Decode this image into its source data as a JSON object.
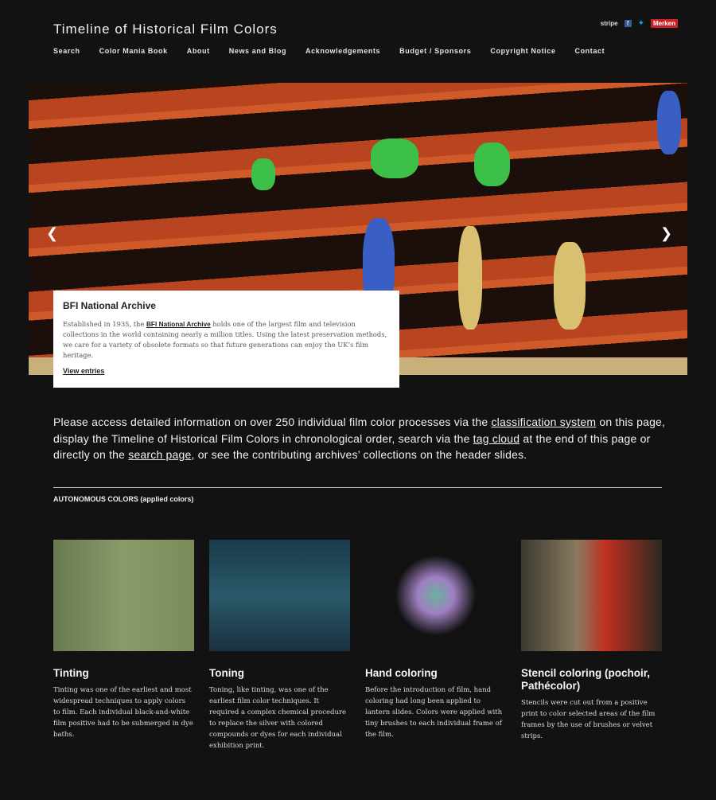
{
  "header": {
    "title": "Timeline of Historical Film Colors",
    "social": {
      "stripe": "stripe",
      "facebook": "f",
      "twitter": "🐦",
      "pinterest": "Merken"
    }
  },
  "nav": [
    "Search",
    "Color Mania Book",
    "About",
    "News and Blog",
    "Acknowledgements",
    "Budget / Sponsors",
    "Copyright Notice",
    "Contact"
  ],
  "slider": {
    "prev": "❮",
    "next": "❯",
    "caption": {
      "title": "BFI National Archive",
      "text_before": "Established in 1935, the ",
      "link": "BFI National Archive",
      "text_after": " holds one of the largest film and television collections in the world containing nearly a million titles. Using the latest preservation methods, we care for a variety of obsolete formats so that future generations can enjoy the UK’s film heritage.",
      "view": "View entries"
    }
  },
  "intro": {
    "p1": "Please access detailed information on over 250 individual film color processes via the ",
    "l1": "classification system",
    "p2": " on this page, display the Timeline of Historical Film Colors in chronological order, search via the ",
    "l2": "tag cloud",
    "p3": " at the end of this page or directly on the ",
    "l3": "search page",
    "p4": ", or see the contributing archives’ collections on the header slides."
  },
  "section": "AUTONOMOUS COLORS (applied colors)",
  "cards": [
    {
      "title": "Tinting",
      "text": "Tinting was one of the earliest and most widespread techniques to apply colors to film. Each individual black-and-white film positive had to be submerged in dye baths."
    },
    {
      "title": "Toning",
      "text": "Toning, like tinting, was one of the earliest film color techniques. It required a complex chemical procedure to replace the silver with colored compounds or dyes for each individual exhibition print."
    },
    {
      "title": "Hand coloring",
      "text": "Before the introduction of film, hand coloring had long been applied to lantern slides. Colors were applied with tiny brushes to each individual frame of the film."
    },
    {
      "title": "Stencil coloring (pochoir, Pathécolor)",
      "text": "Stencils were cut out from a positive print to color selected areas of the film frames by the use of brushes or velvet strips."
    }
  ]
}
